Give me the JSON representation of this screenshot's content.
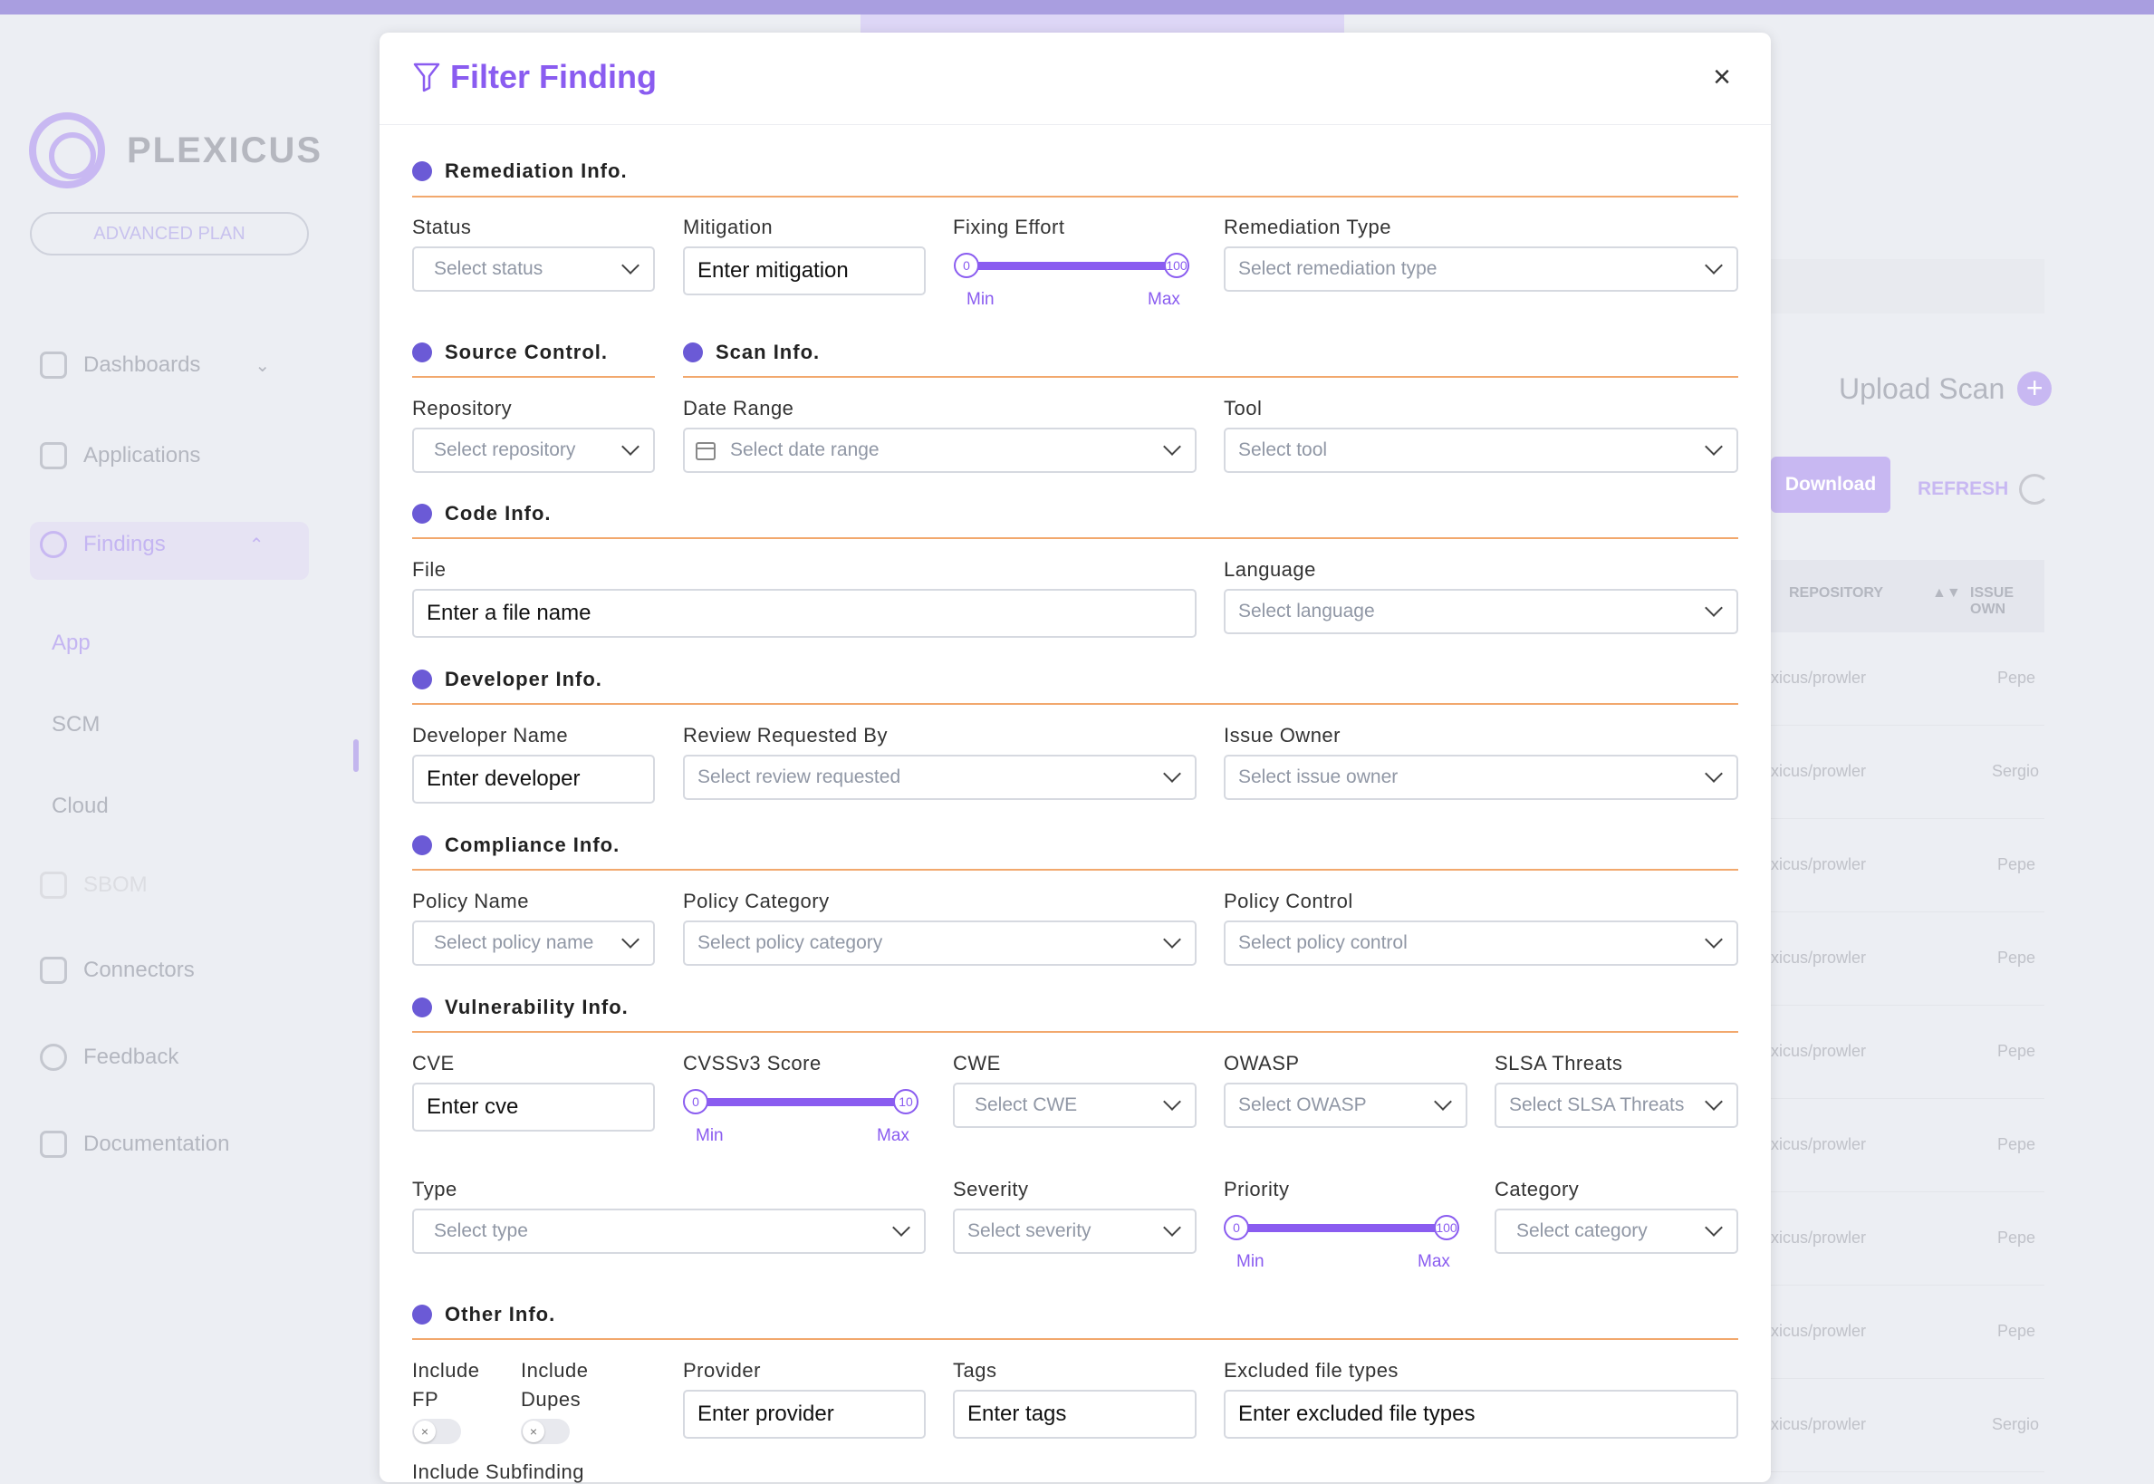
{
  "background": {
    "brand": "PLEXICUS",
    "plan": "ADVANCED PLAN",
    "nav": [
      {
        "label": "Dashboards",
        "icon": "grid-icon"
      },
      {
        "label": "Applications",
        "icon": "applications-icon"
      },
      {
        "label": "Findings",
        "icon": "findings-icon"
      },
      {
        "label": "SBOM",
        "icon": "sbom-icon"
      },
      {
        "label": "Connectors",
        "icon": "connectors-icon"
      },
      {
        "label": "Feedback",
        "icon": "lightbulb-icon"
      },
      {
        "label": "Documentation",
        "icon": "documentation-icon"
      }
    ],
    "findings_sub": [
      "App",
      "SCM",
      "Cloud"
    ],
    "upload_scan": "Upload Scan",
    "download": "Download",
    "refresh": "REFRESH",
    "table_headers": [
      "REPOSITORY",
      "ISSUE OWN"
    ],
    "rows": [
      {
        "repo": "xicus/prowler",
        "owner": "Pepe"
      },
      {
        "repo": "xicus/prowler",
        "owner": "Sergio"
      },
      {
        "repo": "xicus/prowler",
        "owner": "Pepe"
      },
      {
        "repo": "xicus/prowler",
        "owner": "Pepe"
      },
      {
        "repo": "xicus/prowler",
        "owner": "Pepe"
      },
      {
        "repo": "xicus/prowler",
        "owner": "Pepe"
      },
      {
        "repo": "xicus/prowler",
        "owner": "Pepe"
      },
      {
        "repo": "xicus/prowler",
        "owner": "Pepe"
      },
      {
        "repo": "xicus/prowler",
        "owner": "Sergio"
      }
    ]
  },
  "modal": {
    "title": "Filter Finding",
    "close": "×",
    "sections": {
      "remediation": "Remediation Info.",
      "source": "Source Control.",
      "scan": "Scan Info.",
      "code": "Code Info.",
      "developer": "Developer Info.",
      "compliance": "Compliance Info.",
      "vulnerability": "Vulnerability Info.",
      "other": "Other Info."
    },
    "fields": {
      "status": {
        "label": "Status",
        "placeholder": "Select status"
      },
      "mitigation": {
        "label": "Mitigation",
        "placeholder": "Enter mitigation"
      },
      "fixing_effort": {
        "label": "Fixing Effort",
        "min": "0",
        "max": "100",
        "min_label": "Min",
        "max_label": "Max"
      },
      "remediation_type": {
        "label": "Remediation Type",
        "placeholder": "Select remediation type"
      },
      "repository": {
        "label": "Repository",
        "placeholder": "Select repository"
      },
      "date_range": {
        "label": "Date Range",
        "placeholder": "Select date range"
      },
      "tool": {
        "label": "Tool",
        "placeholder": "Select tool"
      },
      "file": {
        "label": "File",
        "placeholder": "Enter a file name"
      },
      "language": {
        "label": "Language",
        "placeholder": "Select language"
      },
      "developer_name": {
        "label": "Developer Name",
        "placeholder": "Enter developer"
      },
      "review_requested": {
        "label": "Review Requested By",
        "placeholder": "Select review requested"
      },
      "issue_owner": {
        "label": "Issue Owner",
        "placeholder": "Select issue owner"
      },
      "policy_name": {
        "label": "Policy Name",
        "placeholder": "Select policy name"
      },
      "policy_category": {
        "label": "Policy Category",
        "placeholder": "Select policy category"
      },
      "policy_control": {
        "label": "Policy Control",
        "placeholder": "Select policy control"
      },
      "cve": {
        "label": "CVE",
        "placeholder": "Enter cve"
      },
      "cvss": {
        "label": "CVSSv3 Score",
        "min": "0",
        "max": "10",
        "min_label": "Min",
        "max_label": "Max"
      },
      "cwe": {
        "label": "CWE",
        "placeholder": "Select CWE"
      },
      "owasp": {
        "label": "OWASP",
        "placeholder": "Select OWASP"
      },
      "slsa": {
        "label": "SLSA Threats",
        "placeholder": "Select SLSA Threats"
      },
      "type": {
        "label": "Type",
        "placeholder": "Select type"
      },
      "severity": {
        "label": "Severity",
        "placeholder": "Select severity"
      },
      "priority": {
        "label": "Priority",
        "min": "0",
        "max": "100",
        "min_label": "Min",
        "max_label": "Max"
      },
      "category": {
        "label": "Category",
        "placeholder": "Select category"
      },
      "include_fp": {
        "label1": "Include",
        "label2": "FP",
        "value": false
      },
      "include_dupes": {
        "label1": "Include",
        "label2": "Dupes",
        "value": false
      },
      "provider": {
        "label": "Provider",
        "placeholder": "Enter provider"
      },
      "tags": {
        "label": "Tags",
        "placeholder": "Enter tags"
      },
      "excluded": {
        "label": "Excluded file types",
        "placeholder": "Enter excluded file types"
      },
      "include_subfinding": {
        "label": "Include Subfinding"
      }
    }
  },
  "colors": {
    "accent": "#8a5cf0",
    "section_dot": "#6b5ad6",
    "section_line": "#f2a86d"
  }
}
